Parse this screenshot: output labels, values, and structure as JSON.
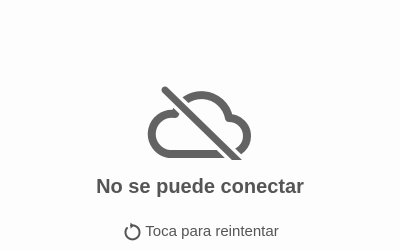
{
  "error": {
    "icon": "cloud-off-icon",
    "message": "No se puede conectar"
  },
  "retry": {
    "icon": "refresh-icon",
    "label": "Toca para reintentar"
  },
  "colors": {
    "background": "#fdfdfd",
    "icon": "#636363",
    "text": "#555555"
  }
}
